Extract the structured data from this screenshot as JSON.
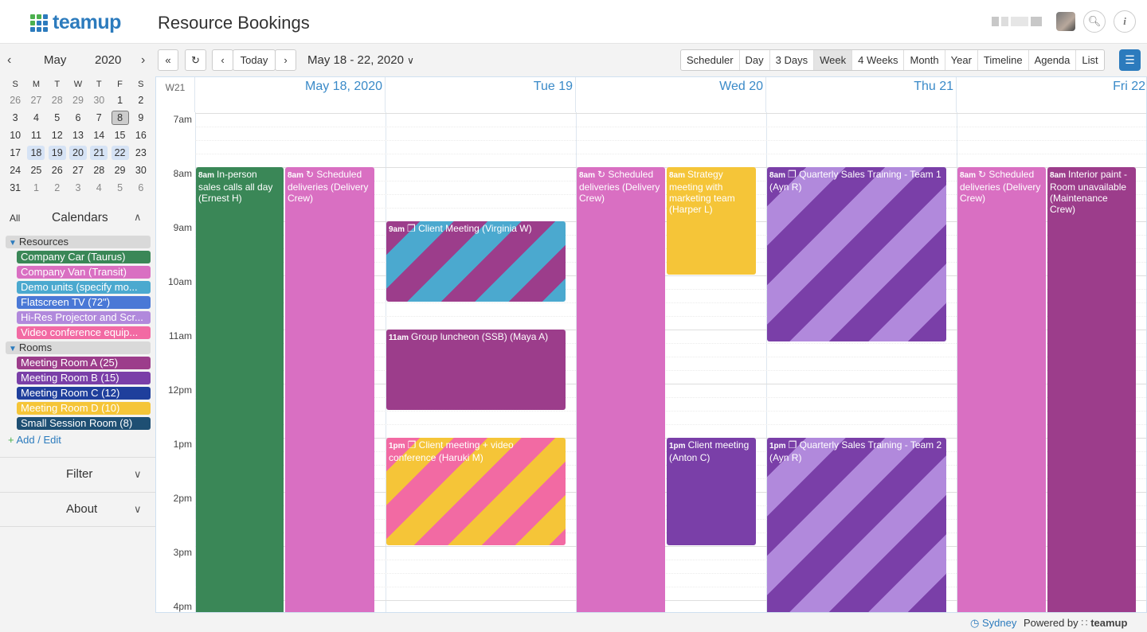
{
  "header": {
    "logo_text": "teamup",
    "page_title": "Resource Bookings"
  },
  "mini_calendar": {
    "month": "May",
    "year": "2020",
    "weekdays": [
      "S",
      "M",
      "T",
      "W",
      "T",
      "F",
      "S"
    ],
    "weeks": [
      [
        "26",
        "27",
        "28",
        "29",
        "30",
        "1",
        "2"
      ],
      [
        "3",
        "4",
        "5",
        "6",
        "7",
        "8",
        "9"
      ],
      [
        "10",
        "11",
        "12",
        "13",
        "14",
        "15",
        "16"
      ],
      [
        "17",
        "18",
        "19",
        "20",
        "21",
        "22",
        "23"
      ],
      [
        "24",
        "25",
        "26",
        "27",
        "28",
        "29",
        "30"
      ],
      [
        "31",
        "1",
        "2",
        "3",
        "4",
        "5",
        "6"
      ]
    ]
  },
  "calendars": {
    "all_label": "All",
    "title": "Calendars",
    "resources_label": "Resources",
    "rooms_label": "Rooms",
    "resources": [
      {
        "name": "Company Car (Taurus)",
        "color": "#3a8757"
      },
      {
        "name": "Company Van (Transit)",
        "color": "#d96fc2"
      },
      {
        "name": "Demo units (specify mo...",
        "color": "#4ba9cf"
      },
      {
        "name": "Flatscreen TV (72\")",
        "color": "#4a78d6"
      },
      {
        "name": "Hi-Res Projector and Scr...",
        "color": "#b189dc"
      },
      {
        "name": "Video conference equip...",
        "color": "#f26aa3"
      }
    ],
    "rooms": [
      {
        "name": "Meeting Room A (25)",
        "color": "#9c3d8b"
      },
      {
        "name": "Meeting Room B (15)",
        "color": "#7a3fa8"
      },
      {
        "name": "Meeting Room C (12)",
        "color": "#1f3f9c"
      },
      {
        "name": "Meeting Room D (10)",
        "color": "#f5c538"
      },
      {
        "name": "Small Session Room (8)",
        "color": "#1e4f73"
      }
    ],
    "add_edit": "Add / Edit"
  },
  "sections": {
    "filter": "Filter",
    "about": "About"
  },
  "toolbar": {
    "today": "Today",
    "date_range": "May 18 - 22, 2020",
    "views": [
      "Scheduler",
      "Day",
      "3 Days",
      "Week",
      "4 Weeks",
      "Month",
      "Year",
      "Timeline",
      "Agenda",
      "List"
    ],
    "active_view": "Week"
  },
  "grid": {
    "week_label": "W21",
    "days": [
      "May 18, 2020",
      "Tue 19",
      "Wed 20",
      "Thu 21",
      "Fri 22"
    ],
    "hours": [
      "7am",
      "8am",
      "9am",
      "10am",
      "11am",
      "12pm",
      "1pm",
      "2pm",
      "3pm",
      "4pm"
    ]
  },
  "events": {
    "e1": {
      "time": "8am",
      "title": "In-person sales calls all day (Ernest H)"
    },
    "e2": {
      "time": "8am",
      "title": "Scheduled deliveries (Delivery Crew)"
    },
    "e3": {
      "time": "9am",
      "title": "Client Meeting (Virginia W)"
    },
    "e4": {
      "time": "11am",
      "title": "Group luncheon (SSB) (Maya A)"
    },
    "e5": {
      "time": "1pm",
      "title": "Client meeting + video conference (Haruki M)"
    },
    "e6": {
      "time": "8am",
      "title": "Scheduled deliveries (Delivery Crew)"
    },
    "e7": {
      "time": "8am",
      "title": "Strategy meeting with marketing team (Harper L)"
    },
    "e8": {
      "time": "1pm",
      "title": "Client meeting (Anton C)"
    },
    "e9": {
      "time": "8am",
      "title": "Quarterly Sales Training - Team 1 (Ayn R)"
    },
    "e10": {
      "time": "1pm",
      "title": "Quarterly Sales Training - Team 2 (Ayn R)"
    },
    "e11": {
      "time": "8am",
      "title": "Scheduled deliveries (Delivery Crew)"
    },
    "e12": {
      "time": "8am",
      "title": "Interior paint - Room unavailable (Maintenance Crew)"
    }
  },
  "footer": {
    "timezone": "Sydney",
    "powered_by": "Powered by",
    "brand": "teamup"
  }
}
